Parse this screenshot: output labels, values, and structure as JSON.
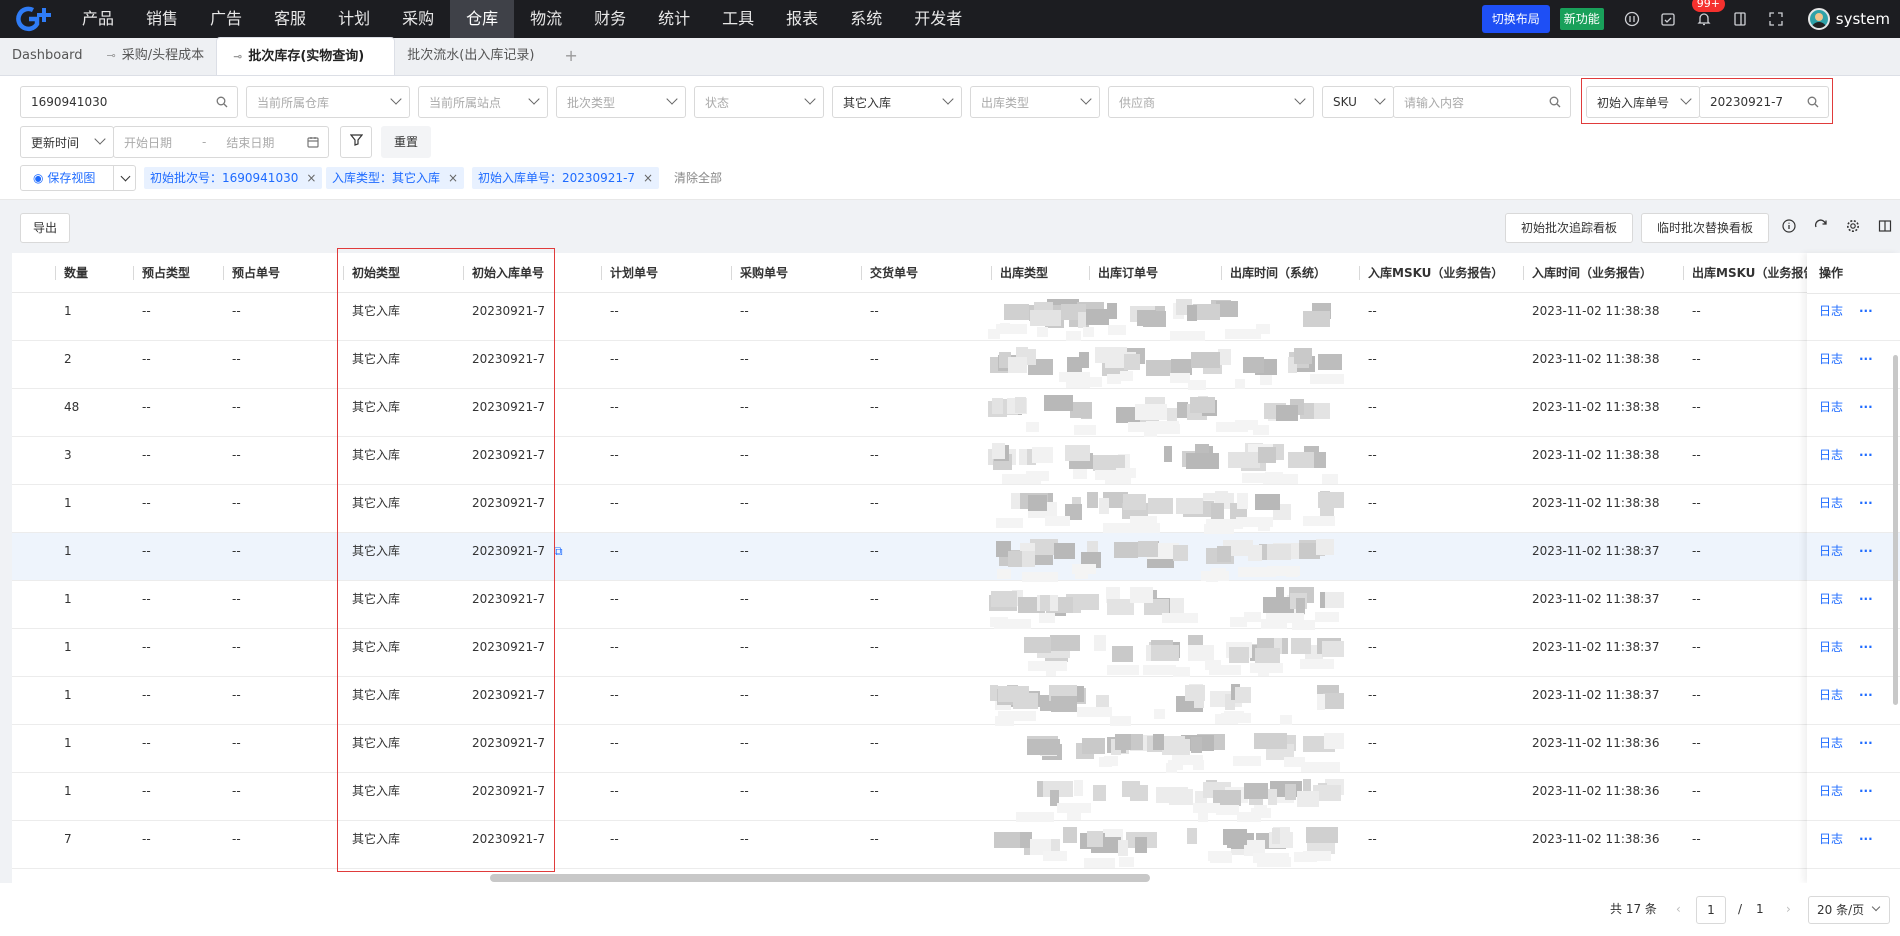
{
  "nav": {
    "items": [
      "产品",
      "销售",
      "广告",
      "客服",
      "计划",
      "采购",
      "仓库",
      "物流",
      "财务",
      "统计",
      "工具",
      "报表",
      "系统",
      "开发者"
    ],
    "active_index": 6,
    "switch_layout": "切换布局",
    "new_feature": "新功能",
    "notification_count": "99+",
    "username": "system"
  },
  "tabs": {
    "home": "Dashboard",
    "items": [
      "采购/头程成本",
      "批次库存(实物查询)",
      "批次流水(出入库记录)"
    ],
    "active_index": 1,
    "add": "+"
  },
  "filters": {
    "batch_no": "1690941030",
    "warehouse_ph": "当前所属仓库",
    "station_ph": "当前所属站点",
    "batch_type_ph": "批次类型",
    "status_ph": "状态",
    "inbound_type": "其它入库",
    "outbound_type_ph": "出库类型",
    "supplier_ph": "供应商",
    "sku_label": "SKU",
    "sku_ph": "请输入内容",
    "inbound_no_label": "初始入库单号",
    "inbound_no_value": "20230921-7",
    "update_time": "更新时间",
    "start_date_ph": "开始日期",
    "date_sep": "-",
    "end_date_ph": "结束日期",
    "reset": "重置",
    "save_view": "保存视图",
    "chips": [
      "初始批次号：1690941030",
      "入库类型：其它入库",
      "初始入库单号：20230921-7"
    ],
    "clear_all": "清除全部"
  },
  "toolbar": {
    "export": "导出",
    "trace_board": "初始批次追踪看板",
    "replace_board": "临时批次替换看板"
  },
  "table": {
    "columns": [
      "数量",
      "预占类型",
      "预占单号",
      "初始类型",
      "初始入库单号",
      "计划单号",
      "采购单号",
      "交货单号",
      "出库类型",
      "出库订单号",
      "出库时间（系统）",
      "入库MSKU（业务报告）",
      "入库时间（业务报告）",
      "出库MSKU（业务报告）",
      "操作"
    ],
    "rows": [
      {
        "qty": "1",
        "reserve_type": "--",
        "reserve_no": "--",
        "init_type": "其它入库",
        "init_no": "20230921-7",
        "plan_no": "--",
        "po_no": "--",
        "delivery_no": "--",
        "in_msku": "--",
        "in_time": "2023-11-02 11:38:38",
        "out_msku": "--"
      },
      {
        "qty": "2",
        "reserve_type": "--",
        "reserve_no": "--",
        "init_type": "其它入库",
        "init_no": "20230921-7",
        "plan_no": "--",
        "po_no": "--",
        "delivery_no": "--",
        "in_msku": "--",
        "in_time": "2023-11-02 11:38:38",
        "out_msku": "--"
      },
      {
        "qty": "48",
        "reserve_type": "--",
        "reserve_no": "--",
        "init_type": "其它入库",
        "init_no": "20230921-7",
        "plan_no": "--",
        "po_no": "--",
        "delivery_no": "--",
        "in_msku": "--",
        "in_time": "2023-11-02 11:38:38",
        "out_msku": "--"
      },
      {
        "qty": "3",
        "reserve_type": "--",
        "reserve_no": "--",
        "init_type": "其它入库",
        "init_no": "20230921-7",
        "plan_no": "--",
        "po_no": "--",
        "delivery_no": "--",
        "in_msku": "--",
        "in_time": "2023-11-02 11:38:38",
        "out_msku": "--"
      },
      {
        "qty": "1",
        "reserve_type": "--",
        "reserve_no": "--",
        "init_type": "其它入库",
        "init_no": "20230921-7",
        "plan_no": "--",
        "po_no": "--",
        "delivery_no": "--",
        "in_msku": "--",
        "in_time": "2023-11-02 11:38:38",
        "out_msku": "--"
      },
      {
        "qty": "1",
        "reserve_type": "--",
        "reserve_no": "--",
        "init_type": "其它入库",
        "init_no": "20230921-7",
        "plan_no": "--",
        "po_no": "--",
        "delivery_no": "--",
        "in_msku": "--",
        "in_time": "2023-11-02 11:38:37",
        "out_msku": "--"
      },
      {
        "qty": "1",
        "reserve_type": "--",
        "reserve_no": "--",
        "init_type": "其它入库",
        "init_no": "20230921-7",
        "plan_no": "--",
        "po_no": "--",
        "delivery_no": "--",
        "in_msku": "--",
        "in_time": "2023-11-02 11:38:37",
        "out_msku": "--"
      },
      {
        "qty": "1",
        "reserve_type": "--",
        "reserve_no": "--",
        "init_type": "其它入库",
        "init_no": "20230921-7",
        "plan_no": "--",
        "po_no": "--",
        "delivery_no": "--",
        "in_msku": "--",
        "in_time": "2023-11-02 11:38:37",
        "out_msku": "--"
      },
      {
        "qty": "1",
        "reserve_type": "--",
        "reserve_no": "--",
        "init_type": "其它入库",
        "init_no": "20230921-7",
        "plan_no": "--",
        "po_no": "--",
        "delivery_no": "--",
        "in_msku": "--",
        "in_time": "2023-11-02 11:38:37",
        "out_msku": "--"
      },
      {
        "qty": "1",
        "reserve_type": "--",
        "reserve_no": "--",
        "init_type": "其它入库",
        "init_no": "20230921-7",
        "plan_no": "--",
        "po_no": "--",
        "delivery_no": "--",
        "in_msku": "--",
        "in_time": "2023-11-02 11:38:36",
        "out_msku": "--"
      },
      {
        "qty": "1",
        "reserve_type": "--",
        "reserve_no": "--",
        "init_type": "其它入库",
        "init_no": "20230921-7",
        "plan_no": "--",
        "po_no": "--",
        "delivery_no": "--",
        "in_msku": "--",
        "in_time": "2023-11-02 11:38:36",
        "out_msku": "--"
      },
      {
        "qty": "7",
        "reserve_type": "--",
        "reserve_no": "--",
        "init_type": "其它入库",
        "init_no": "20230921-7",
        "plan_no": "--",
        "po_no": "--",
        "delivery_no": "--",
        "in_msku": "--",
        "in_time": "2023-11-02 11:38:36",
        "out_msku": "--"
      }
    ],
    "highlighted_row": 5,
    "log_label": "日志",
    "more_label": "···"
  },
  "pagination": {
    "total": "共 17 条",
    "current": "1",
    "sep": "/",
    "pages": "1",
    "page_size": "20 条/页"
  },
  "colors": {
    "nav_bg": "#1c1d21",
    "accent": "#1e6bff",
    "highlight_box": "#e03b3b",
    "new_badge": "#19a05a",
    "notification_badge": "#f5312e"
  }
}
